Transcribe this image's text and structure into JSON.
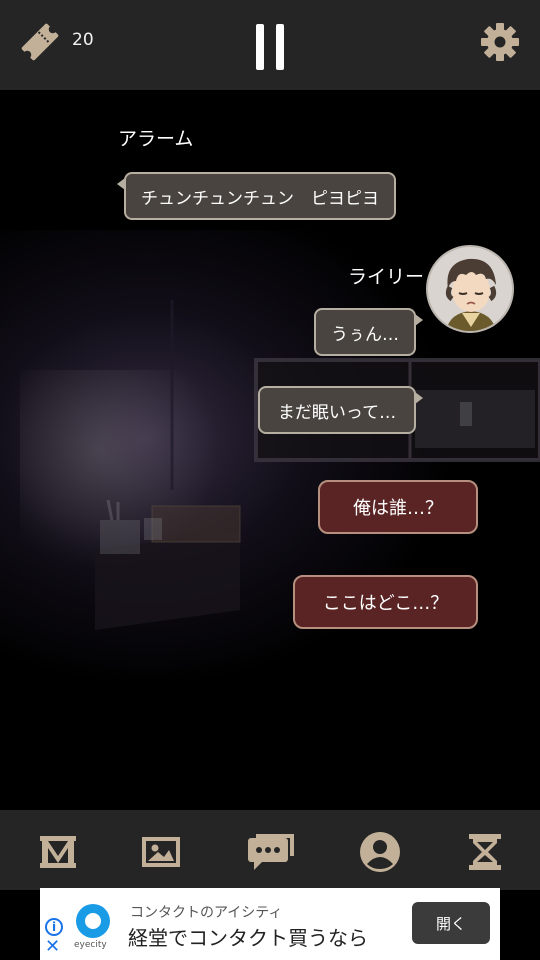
{
  "header": {
    "ticket_count": "20",
    "ticket_icon": "ticket-icon",
    "pause_icon": "pause-icon",
    "settings_icon": "gear-icon"
  },
  "dialogue": {
    "alarm": {
      "speaker": "アラーム",
      "text": "チュンチュンチュン　ピヨピヨ"
    },
    "riley": {
      "speaker": "ライリー",
      "lines": [
        "うぅん…",
        "まだ眠いって…"
      ]
    },
    "choices": [
      "俺は誰…？",
      "ここはどこ…？"
    ]
  },
  "bottom_nav": {
    "items": [
      "map-icon",
      "image-icon",
      "chat-log-icon",
      "profile-icon",
      "hourglass-icon"
    ]
  },
  "ad": {
    "brand": "eyecity",
    "subtitle": "コンタクトのアイシティ",
    "title": "経堂でコンタクト買うなら",
    "open_label": "開く"
  },
  "colors": {
    "bar_bg": "#262525",
    "icon_tan": "#c2b198",
    "bubble_bg": "#49443f",
    "choice_bg": "#5a2424"
  }
}
